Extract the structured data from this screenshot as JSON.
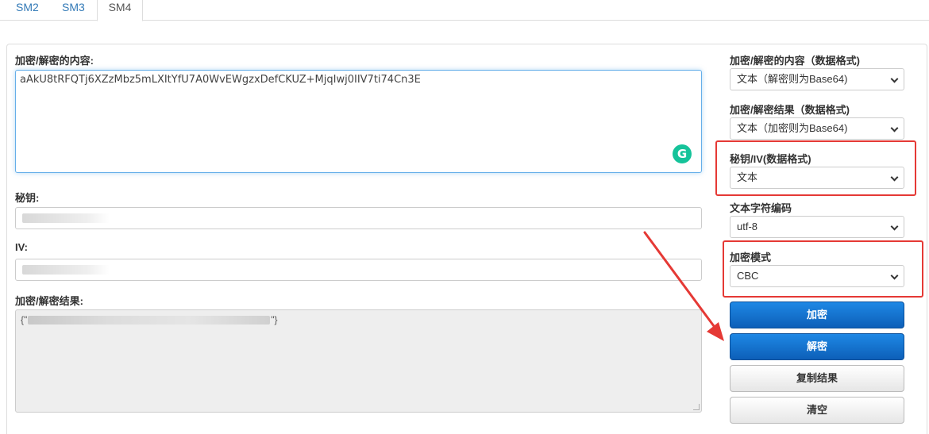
{
  "tabs": [
    {
      "label": "SM2"
    },
    {
      "label": "SM3"
    },
    {
      "label": "SM4"
    }
  ],
  "left": {
    "content_label": "加密/解密的内容:",
    "content_value": "aAkU8tRFQTj6XZzMbz5mLXItYfU7A0WvEWgzxDefCKUZ+MjqIwj0IIV7ti74Cn3E",
    "key_label": "秘钥:",
    "iv_label": "IV:",
    "result_label": "加密/解密结果:",
    "result_prefix": "{\"",
    "result_suffix": "\"}"
  },
  "right": {
    "content_format_label": "加密/解密的内容（数据格式)",
    "content_format_value": "文本（解密则为Base64)",
    "result_format_label": "加密/解密结果（数据格式)",
    "result_format_value": "文本（加密则为Base64)",
    "key_format_label": "秘钥/IV(数据格式)",
    "key_format_value": "文本",
    "encoding_label": "文本字符编码",
    "encoding_value": "utf-8",
    "mode_label": "加密模式",
    "mode_value": "CBC",
    "encrypt_button": "加密",
    "decrypt_button": "解密",
    "copy_button": "复制结果",
    "clear_button": "清空"
  },
  "colors": {
    "primary": "#0d5fb8",
    "highlight": "#e53935",
    "link": "#337ab7"
  }
}
